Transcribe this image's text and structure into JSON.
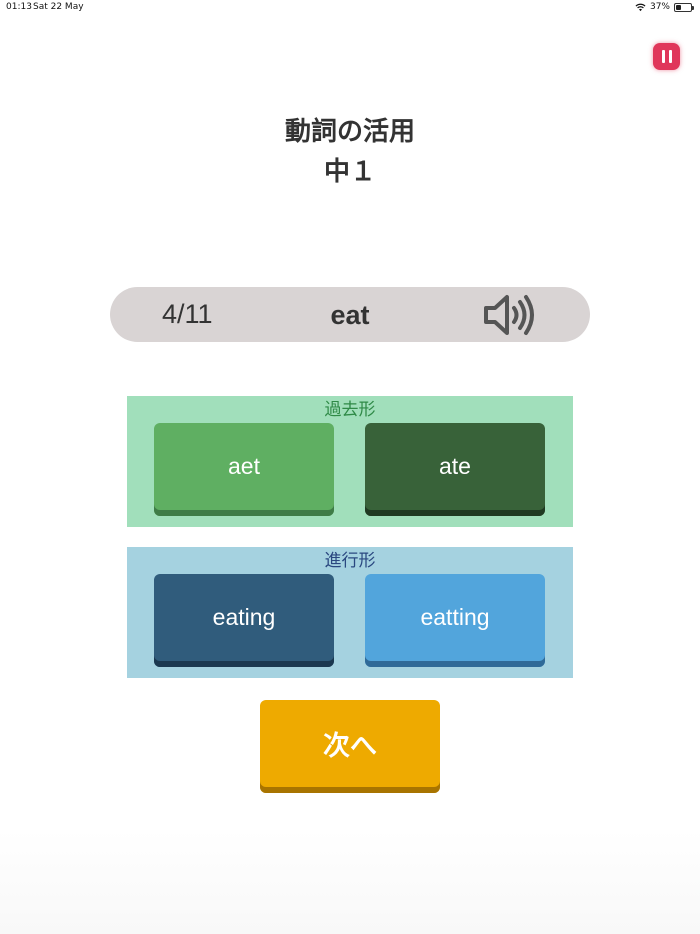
{
  "status_bar": {
    "time": "01:13",
    "date": "Sat 22 May",
    "battery": "37%",
    "battery_level": 0.37
  },
  "header": {
    "title_line1": "動詞の活用",
    "title_line2": "中１"
  },
  "question": {
    "counter": "4/11",
    "word": "eat",
    "speaker_icon": "speaker-icon"
  },
  "groups": [
    {
      "label": "過去形",
      "color": "#a1dfbb",
      "choices": [
        "aet",
        "ate"
      ]
    },
    {
      "label": "進行形",
      "color": "#a5d2e0",
      "choices": [
        "eating",
        "eatting"
      ]
    }
  ],
  "next_button": {
    "label": "次へ",
    "color": "#eeaa00"
  },
  "colors": {
    "pause": "#e0365a",
    "question_bar": "#d9d4d4"
  }
}
